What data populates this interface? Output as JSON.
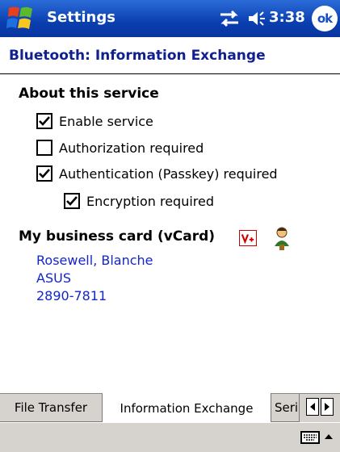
{
  "titlebar": {
    "title": "Settings",
    "clock": "3:38",
    "ok_label": "ok"
  },
  "header": {
    "title": "Bluetooth: Information Exchange"
  },
  "about": {
    "section_title": "About this service",
    "options": [
      {
        "label": "Enable service",
        "checked": true
      },
      {
        "label": "Authorization required",
        "checked": false
      },
      {
        "label": "Authentication (Passkey) required",
        "checked": true
      },
      {
        "label": "Encryption required",
        "checked": true
      }
    ]
  },
  "vcard": {
    "title": "My business card (vCard)",
    "lines": [
      "Rosewell, Blanche",
      "ASUS",
      "2890-7811"
    ]
  },
  "tabs": [
    "File Transfer",
    "Information Exchange",
    "Seri"
  ],
  "colors": {
    "title_bar": "#0a3fb0",
    "header_text": "#10208e",
    "contact_text": "#1326c7",
    "tab_background": "#d6d3ce"
  }
}
